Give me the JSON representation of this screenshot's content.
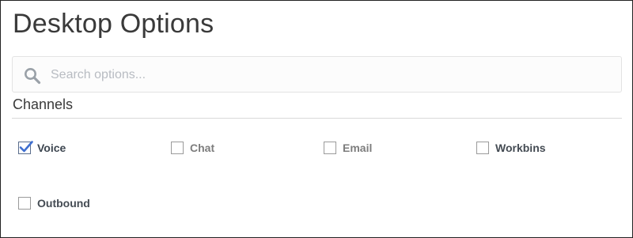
{
  "page": {
    "title": "Desktop Options"
  },
  "search": {
    "placeholder": "Search options...",
    "value": "",
    "icon": "search-icon"
  },
  "channels": {
    "heading": "Channels",
    "options": [
      {
        "label": "Voice",
        "checked": true
      },
      {
        "label": "Chat",
        "checked": false
      },
      {
        "label": "Email",
        "checked": false
      },
      {
        "label": "Workbins",
        "checked": false
      },
      {
        "label": "Outbound",
        "checked": false
      }
    ]
  },
  "colors": {
    "check_accent": "#3f6fd0",
    "title_text": "#3a3a3a",
    "placeholder_text": "#b8bcc2"
  }
}
